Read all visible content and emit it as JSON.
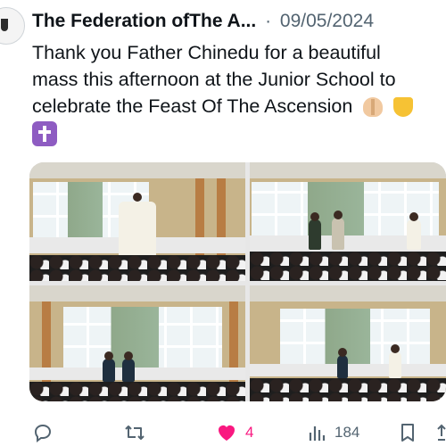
{
  "post": {
    "author_name": "The Federation ofThe A...",
    "separator": "·",
    "date": "09/05/2024",
    "text_lines": [
      "Thank you Father Chinedu for a beautiful",
      "mass this afternoon at the Junior School to",
      "celebrate the Feast Of The Ascension"
    ],
    "emojis": [
      "folded-hands",
      "yellow-heart",
      "latin-cross"
    ]
  },
  "media": {
    "photos": [
      {
        "subject": "priest-at-altar"
      },
      {
        "subject": "readers-at-front"
      },
      {
        "subject": "hall-wide-view"
      },
      {
        "subject": "hall-wide-view-2"
      }
    ]
  },
  "actions": {
    "reply_icon": "reply-icon",
    "retweet_icon": "retweet-icon",
    "like_icon": "heart-icon",
    "like_count": "4",
    "views_icon": "views-icon",
    "views_count": "184",
    "bookmark_icon": "bookmark-icon",
    "share_icon": "share-icon"
  },
  "colors": {
    "text": "#0f1419",
    "secondary": "#536471",
    "like": "#f91880",
    "cross_emoji": "#8e5cc2"
  }
}
